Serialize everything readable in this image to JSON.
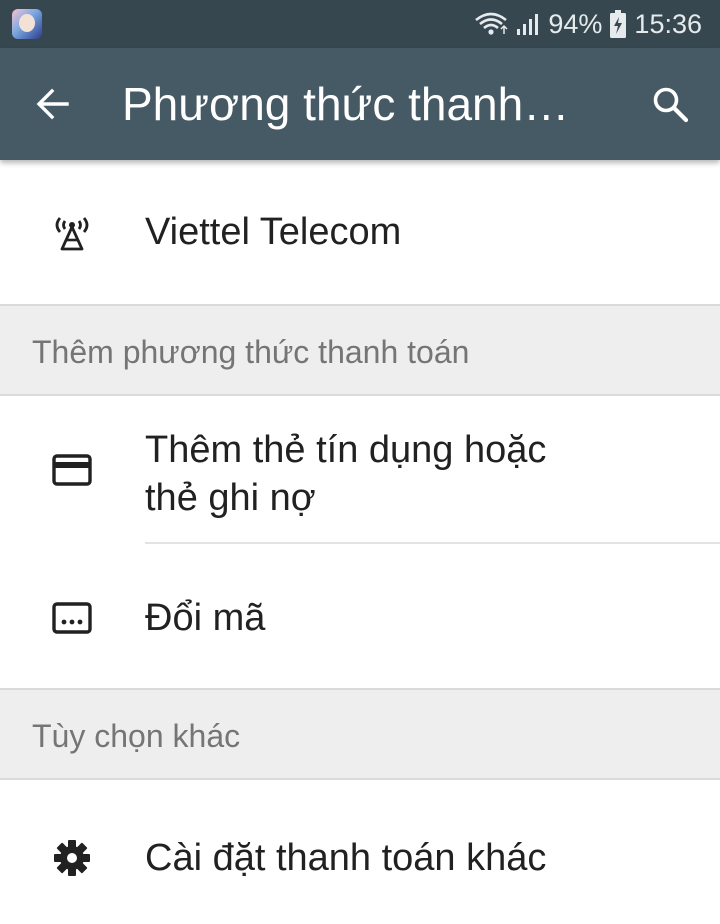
{
  "status_bar": {
    "battery": "94%",
    "time": "15:36",
    "icons": [
      "app-notification-icon",
      "wifi-icon",
      "signal-icon",
      "battery-charging-icon"
    ]
  },
  "app_bar": {
    "title": "Phương thức thanh…",
    "back_icon": "back-arrow-icon",
    "search_icon": "search-icon"
  },
  "list": {
    "current_method": {
      "label": "Viettel Telecom",
      "icon": "carrier-antenna-icon"
    },
    "add_section": {
      "title": "Thêm phương thức thanh toán",
      "items": [
        {
          "line1": "Thêm thẻ tín dụng hoặc",
          "line2": "thẻ ghi nợ",
          "icon": "credit-card-icon"
        },
        {
          "label": "Đổi mã",
          "icon": "redeem-code-icon"
        }
      ]
    },
    "other_section": {
      "title": "Tùy chọn khác",
      "items": [
        {
          "label": "Cài đặt thanh toán khác",
          "icon": "gear-icon"
        }
      ]
    }
  }
}
